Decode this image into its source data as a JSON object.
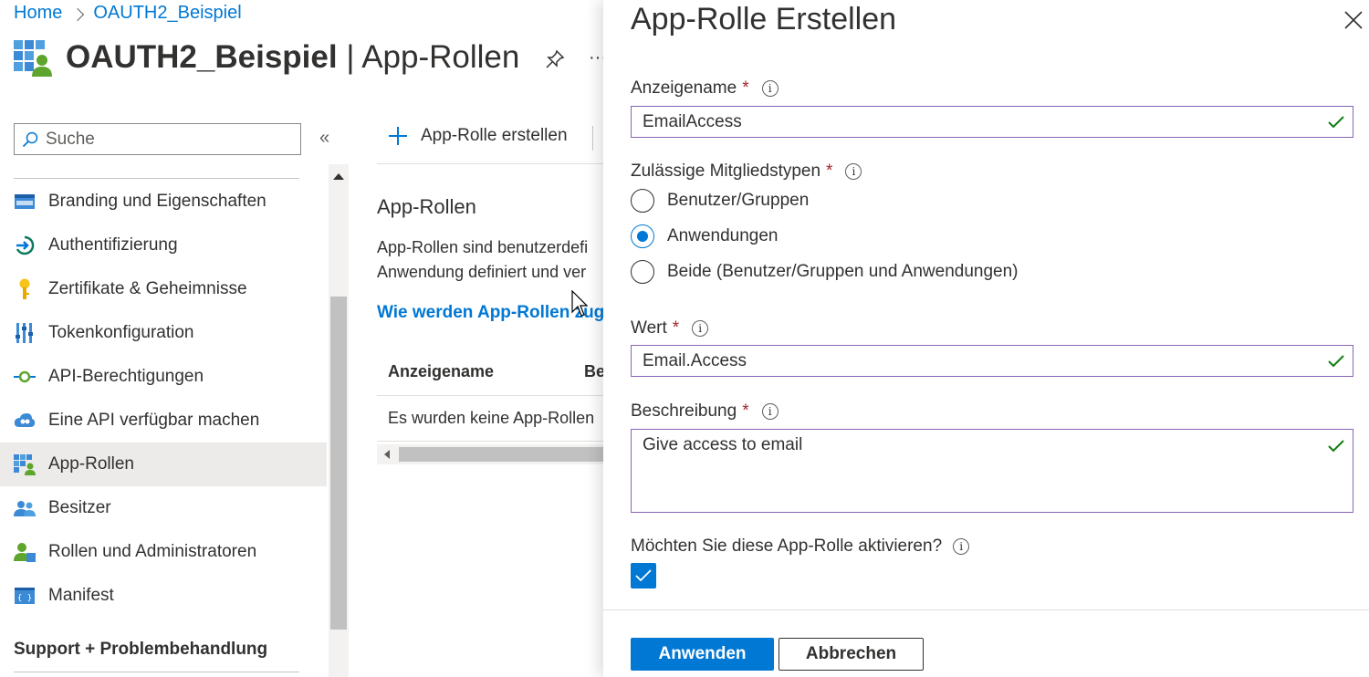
{
  "breadcrumb": {
    "home": "Home",
    "current": "OAUTH2_Beispiel"
  },
  "header": {
    "app_name": "OAUTH2_Beispiel",
    "separator": " | ",
    "section": "App-Rollen",
    "more": "···"
  },
  "sidebar": {
    "search_placeholder": "Suche",
    "collapse": "«",
    "items": [
      {
        "label": "Branding und Eigenschaften",
        "icon": "branding-icon",
        "active": false
      },
      {
        "label": "Authentifizierung",
        "icon": "authentication-icon",
        "active": false
      },
      {
        "label": "Zertifikate & Geheimnisse",
        "icon": "key-icon",
        "active": false
      },
      {
        "label": "Tokenkonfiguration",
        "icon": "token-config-icon",
        "active": false
      },
      {
        "label": "API-Berechtigungen",
        "icon": "api-permissions-icon",
        "active": false
      },
      {
        "label": "Eine API verfügbar machen",
        "icon": "cloud-api-icon",
        "active": false
      },
      {
        "label": "App-Rollen",
        "icon": "app-roles-icon",
        "active": true
      },
      {
        "label": "Besitzer",
        "icon": "owners-icon",
        "active": false
      },
      {
        "label": "Rollen und Administratoren",
        "icon": "roles-admins-icon",
        "active": false
      },
      {
        "label": "Manifest",
        "icon": "manifest-icon",
        "active": false
      }
    ],
    "section_heading": "Support + Problembehandlung"
  },
  "main": {
    "create_button": "App-Rolle erstellen",
    "heading": "App-Rollen",
    "description_line1": "App-Rollen sind benutzerdefi",
    "description_line2": "Anwendung definiert und ver",
    "link": "Wie werden App-Rollen zug",
    "table": {
      "columns": [
        "Anzeigename",
        "Be"
      ],
      "empty_text": "Es wurden keine App-Rollen"
    }
  },
  "panel": {
    "title": "App-Rolle Erstellen",
    "display_name": {
      "label": "Anzeigename",
      "required": "*",
      "value": "EmailAccess"
    },
    "member_types": {
      "label": "Zulässige Mitgliedstypen",
      "required": "*",
      "options": [
        "Benutzer/Gruppen",
        "Anwendungen",
        "Beide (Benutzer/Gruppen und Anwendungen)"
      ],
      "selected": "Anwendungen"
    },
    "value": {
      "label": "Wert",
      "required": "*",
      "value": "Email.Access"
    },
    "description": {
      "label": "Beschreibung",
      "required": "*",
      "value": "Give access to email"
    },
    "enable": {
      "label": "Möchten Sie diese App-Rolle aktivieren?",
      "checked": true
    },
    "apply_button": "Anwenden",
    "cancel_button": "Abbrechen"
  },
  "colors": {
    "accent": "#0078d4",
    "valid_border": "#8764b8",
    "valid_check": "#107c10",
    "required": "#a4262c"
  }
}
